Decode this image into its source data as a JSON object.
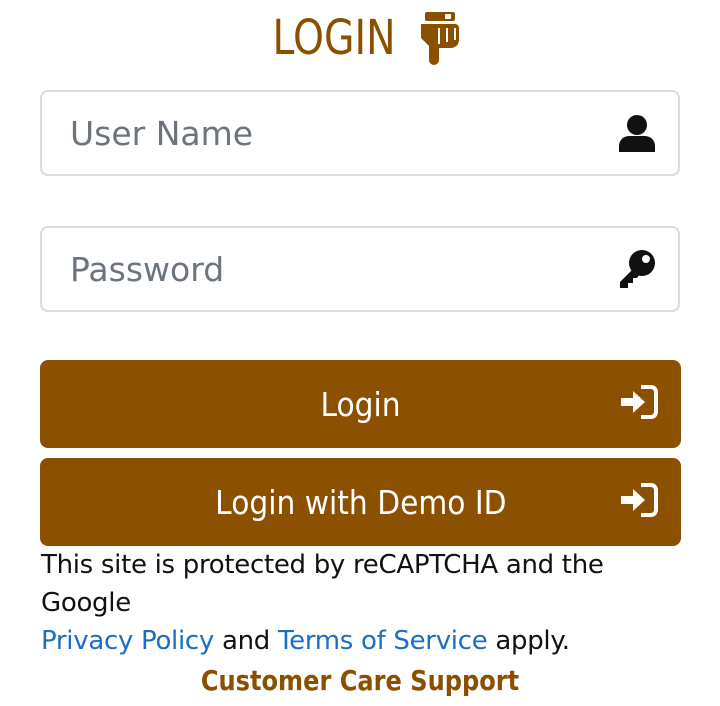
{
  "header": {
    "title": "LOGIN",
    "icon": "pointing-down-hand-icon"
  },
  "form": {
    "username": {
      "placeholder": "User Name",
      "value": "",
      "icon": "user-icon"
    },
    "password": {
      "placeholder": "Password",
      "value": "",
      "icon": "key-icon"
    }
  },
  "buttons": {
    "login_label": "Login",
    "demo_label": "Login with Demo ID",
    "icon": "sign-in-icon"
  },
  "recaptcha": {
    "text_before": "This site is protected by reCAPTCHA and the Google",
    "privacy_link": "Privacy Policy",
    "and_text": "and",
    "terms_link": "Terms of Service",
    "text_after": "apply."
  },
  "support": {
    "label": "Customer Care Support"
  },
  "colors": {
    "brand": "#8b5000",
    "link": "#1a6fc4",
    "border": "#dcdcdc"
  }
}
